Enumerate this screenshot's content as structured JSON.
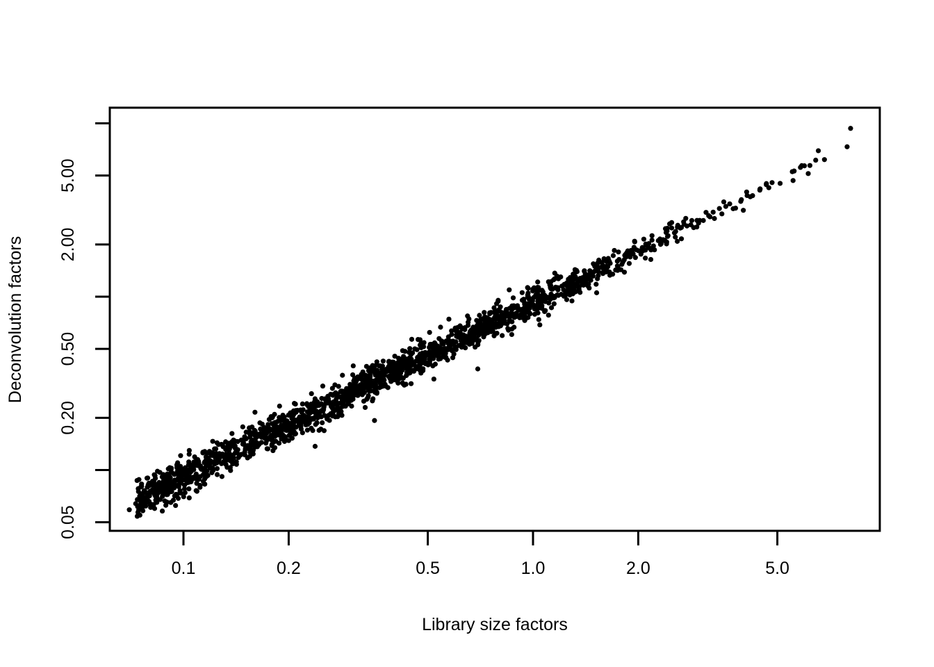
{
  "chart_data": {
    "type": "scatter",
    "title": "",
    "xlabel": "Library size factors",
    "ylabel": "Deconvolution factors",
    "xscale": "log",
    "yscale": "log",
    "grid": false,
    "legend": null,
    "xlim": [
      0.063,
      9.6
    ],
    "ylim": [
      0.046,
      11.6
    ],
    "xticks": [
      0.1,
      0.2,
      0.5,
      1.0,
      2.0,
      5.0
    ],
    "xticklabels": [
      "0.1",
      "0.2",
      "0.5",
      "1.0",
      "2.0",
      "5.0"
    ],
    "yticks": [
      0.05,
      0.1,
      0.2,
      0.5,
      1.0,
      2.0,
      5.0,
      10.0
    ],
    "yticklabels": [
      "0.05",
      "",
      "0.20",
      "0.50",
      "",
      "2.00",
      "5.00",
      ""
    ],
    "ytick_labeled": [
      0.05,
      0.2,
      0.5,
      2.0,
      5.0
    ],
    "point_color": "#000000",
    "point_shape": "filled-circle",
    "point_radius_px": 3.6,
    "n_points": 1800,
    "relationship": "near-identity along y = x on log-log axes; tight monotonic band, spread widens slightly at low values",
    "description": "Scatter of deconvolution size factors against library size factors for single-cell RNA-seq; points fall along the diagonal from about (0.07, 0.055) to (8, 9).",
    "x_range_observed": [
      0.068,
      8.2
    ],
    "y_range_observed": [
      0.055,
      9.4
    ]
  },
  "figure": {
    "background_color": "#ffffff",
    "axis_color": "#000000",
    "box_color": "#000000"
  }
}
